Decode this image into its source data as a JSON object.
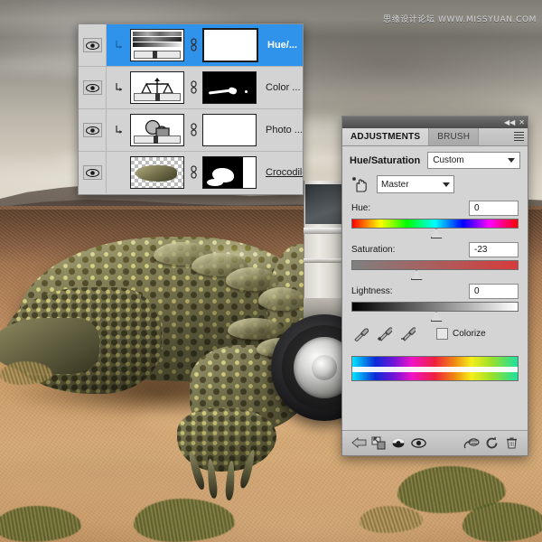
{
  "watermark": "思缘设计论坛  WWW.MISSYUAN.COM",
  "layers_panel": {
    "rows": [
      {
        "name": "Hue/...",
        "visible_icon": "eye-icon",
        "clip_icon": "clipping-mask-icon",
        "thumb_icon": "hue-saturation-thumbnail",
        "link_icon": "link-icon",
        "mask": "white-mask",
        "selected": true
      },
      {
        "name": "Color ...",
        "visible_icon": "eye-icon",
        "clip_icon": "clipping-mask-icon",
        "thumb_icon": "color-balance-thumbnail",
        "link_icon": "link-icon",
        "mask": "black-mask-with-strokes",
        "selected": false
      },
      {
        "name": "Photo ...",
        "visible_icon": "eye-icon",
        "clip_icon": "clipping-mask-icon",
        "thumb_icon": "photo-filter-thumbnail",
        "link_icon": "link-icon",
        "mask": "white-mask",
        "selected": false
      },
      {
        "name": "Crocodile_b...",
        "visible_icon": "eye-icon",
        "clip_icon": "",
        "thumb_icon": "crocodile-layer-thumbnail",
        "link_icon": "link-icon",
        "mask": "black-white-mask",
        "selected": false
      }
    ]
  },
  "adjustments_panel": {
    "titlebar": {
      "collapse_label": "◀◀",
      "close_label": "✕"
    },
    "tabs": [
      {
        "label": "ADJUSTMENTS",
        "active": true
      },
      {
        "label": "BRUSH",
        "active": false
      }
    ],
    "menu_icon": "panel-menu-icon",
    "adjustment_title": "Hue/Saturation",
    "preset": {
      "value": "Custom",
      "caret_icon": "chevron-down-icon"
    },
    "channel": {
      "hand_icon": "targeted-adjustment-hand-icon",
      "value": "Master",
      "caret_icon": "chevron-down-icon"
    },
    "sliders": [
      {
        "label": "Hue:",
        "value": "0",
        "position_pct": 50,
        "track": "hue"
      },
      {
        "label": "Saturation:",
        "value": "-23",
        "position_pct": 38,
        "track": "sat"
      },
      {
        "label": "Lightness:",
        "value": "0",
        "position_pct": 50,
        "track": "light"
      }
    ],
    "eyedroppers": [
      {
        "icon": "eyedropper-icon"
      },
      {
        "icon": "eyedropper-add-icon"
      },
      {
        "icon": "eyedropper-subtract-icon"
      }
    ],
    "colorize": {
      "label": "Colorize",
      "checked": false
    },
    "spectrum_icon": "hue-spectrum-bar",
    "footer_buttons": [
      {
        "icon": "back-arrow-icon"
      },
      {
        "icon": "clip-to-layer-icon"
      },
      {
        "icon": "previous-state-icon"
      },
      {
        "icon": "toggle-visibility-eye-icon"
      },
      {
        "icon": "preview-icon"
      },
      {
        "icon": "reset-icon"
      },
      {
        "icon": "delete-trash-icon"
      }
    ]
  },
  "colors": {
    "selection_blue": "#2f93ec",
    "panel_gray": "#d4d4d4",
    "tab_active": "#dadada"
  }
}
